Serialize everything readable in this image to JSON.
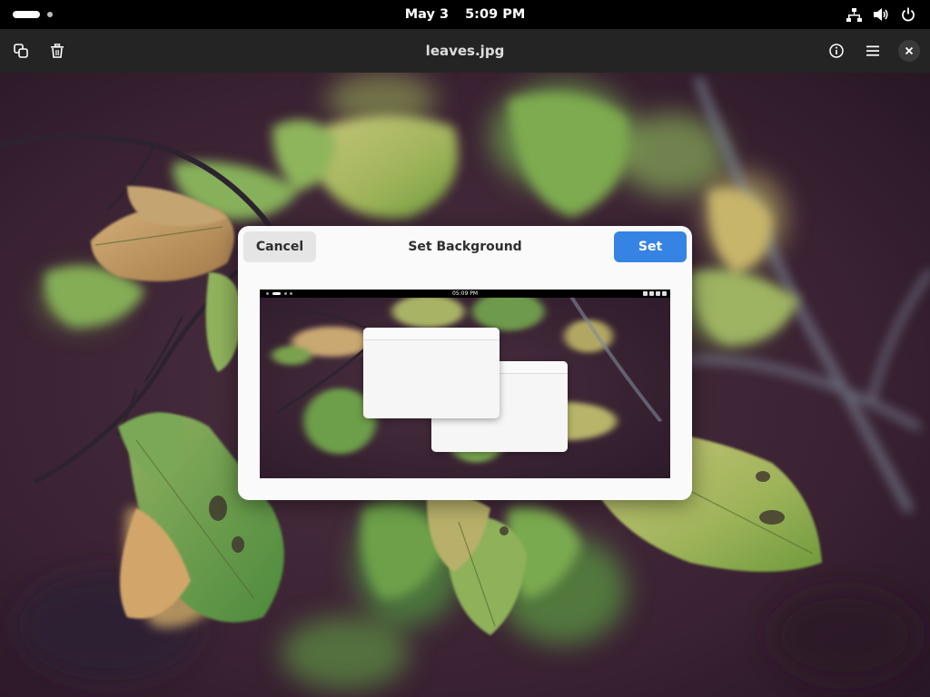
{
  "topbar": {
    "date": "May 3",
    "time": "5:09 PM",
    "icons": [
      "network-icon",
      "volume-icon",
      "power-icon"
    ]
  },
  "header": {
    "title": "leaves.jpg",
    "left_icons": [
      "copy-icon",
      "trash-icon"
    ],
    "right_icons": [
      "info-icon",
      "menu-icon",
      "close-icon"
    ]
  },
  "dialog": {
    "title": "Set Background",
    "cancel_label": "Cancel",
    "set_label": "Set",
    "preview": {
      "clock": "05:09 PM"
    }
  },
  "colors": {
    "accent": "#3584e4",
    "headerbar": "#242424",
    "topbar": "#000000",
    "dialog_bg": "#fafafa"
  }
}
